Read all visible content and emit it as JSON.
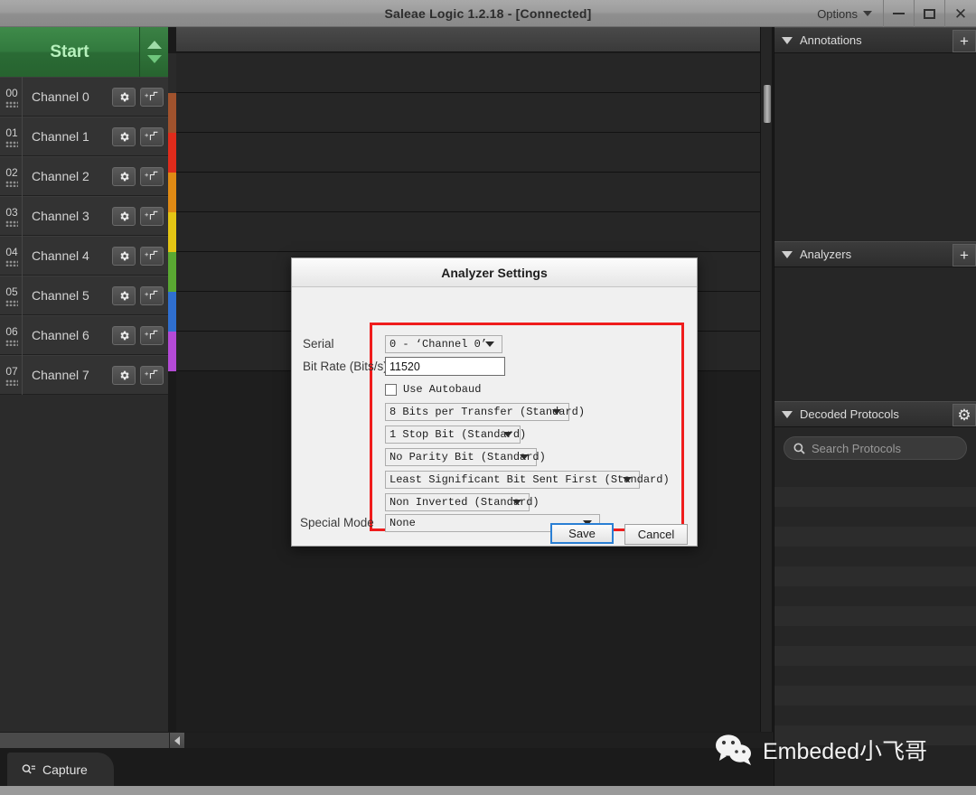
{
  "window": {
    "title": "Saleae Logic 1.2.18 - [Connected]",
    "options_label": "Options",
    "minimize_icon": "minimize-icon",
    "maximize_icon": "maximize-icon",
    "close_icon": "close-icon",
    "close_glyph": "✕"
  },
  "toolbar": {
    "start_label": "Start",
    "scroll_up_icon": "caret-up-icon",
    "scroll_down_icon": "caret-down-icon"
  },
  "channels": {
    "gear_icon": "gear-icon",
    "add_trigger_icon": "add-trigger-icon",
    "items": [
      {
        "num": "00",
        "label": "Channel 0",
        "color": "#2a2a2a"
      },
      {
        "num": "01",
        "label": "Channel 1",
        "color": "#a0522d"
      },
      {
        "num": "02",
        "label": "Channel 2",
        "color": "#e02b1b"
      },
      {
        "num": "03",
        "label": "Channel 3",
        "color": "#e08a14"
      },
      {
        "num": "04",
        "label": "Channel 4",
        "color": "#e4c514"
      },
      {
        "num": "05",
        "label": "Channel 5",
        "color": "#5aa832"
      },
      {
        "num": "06",
        "label": "Channel 6",
        "color": "#2f6fd0"
      },
      {
        "num": "07",
        "label": "Channel 7",
        "color": "#b44ad6"
      }
    ]
  },
  "sidebar": {
    "sections": [
      {
        "title": "Annotations",
        "action": "+",
        "action_icon": "plus-icon"
      },
      {
        "title": "Analyzers",
        "action": "+",
        "action_icon": "plus-icon"
      },
      {
        "title": "Decoded Protocols",
        "action": "⚙",
        "action_icon": "gear-icon"
      }
    ],
    "search": {
      "placeholder": "Search Protocols",
      "icon": "search-icon"
    }
  },
  "bottom": {
    "tab_label": "Capture",
    "tab_icon": "capture-search-icon",
    "scroll_left_icon": "caret-left-icon"
  },
  "watermark": {
    "text": "Embeded小飞哥",
    "icon": "wechat-icon"
  },
  "dialog": {
    "title": "Analyzer Settings",
    "fields": {
      "serial_label": "Serial",
      "serial_value": "0 - ‘Channel 0’",
      "bitrate_label": "Bit Rate (Bits/s)",
      "bitrate_value": "11520",
      "autobaud_label": "Use Autobaud",
      "autobaud_checked": false,
      "bits_per_transfer": "8 Bits per Transfer (Standard)",
      "stop_bit": "1 Stop Bit (Standard)",
      "parity": "No Parity Bit (Standard)",
      "bit_order": "Least Significant Bit Sent First (Standard)",
      "inversion": "Non Inverted (Standard)",
      "special_mode_label": "Special Mode",
      "special_mode_value": "None"
    },
    "buttons": {
      "save": "Save",
      "cancel": "Cancel"
    },
    "highlight_color": "#ef1c1c",
    "focus_color": "#2a7fd4"
  }
}
